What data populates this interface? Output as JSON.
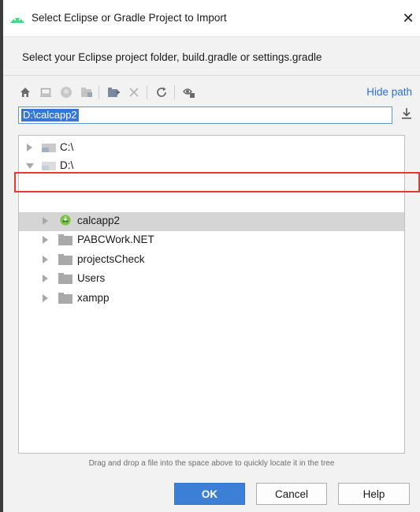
{
  "window": {
    "title": "Select Eclipse or Gradle Project to Import",
    "close_glyph": "✕",
    "app_icon": "android-studio-icon"
  },
  "instruction": "Select your Eclipse project folder, build.gradle or settings.gradle",
  "toolbar": {
    "icons": [
      "home-icon",
      "desktop-icon",
      "project-icon",
      "module-icon",
      "new-folder-icon",
      "delete-icon",
      "refresh-icon",
      "show-hidden-icon"
    ],
    "hide_path_label": "Hide path"
  },
  "path_field": {
    "value": "D:\\calcapp2"
  },
  "tree": {
    "rows": [
      {
        "label": "C:\\",
        "expanded": false,
        "type": "drive"
      },
      {
        "label": "D:\\",
        "expanded": true,
        "type": "drive"
      },
      {
        "label": "calcapp2",
        "expanded": false,
        "type": "android-project",
        "selected": true
      },
      {
        "label": "PABCWork.NET",
        "expanded": false,
        "type": "folder"
      },
      {
        "label": "projectsCheck",
        "expanded": false,
        "type": "folder"
      },
      {
        "label": "Users",
        "expanded": false,
        "type": "folder"
      },
      {
        "label": "xampp",
        "expanded": false,
        "type": "folder"
      }
    ]
  },
  "hint": "Drag and drop a file into the space above to quickly locate it in the tree",
  "buttons": {
    "ok": "OK",
    "cancel": "Cancel",
    "help": "Help"
  },
  "colors": {
    "accent": "#3c7fd6",
    "selection": "#d5d5d5",
    "highlight": "#e53935",
    "link": "#2a6fd8"
  }
}
